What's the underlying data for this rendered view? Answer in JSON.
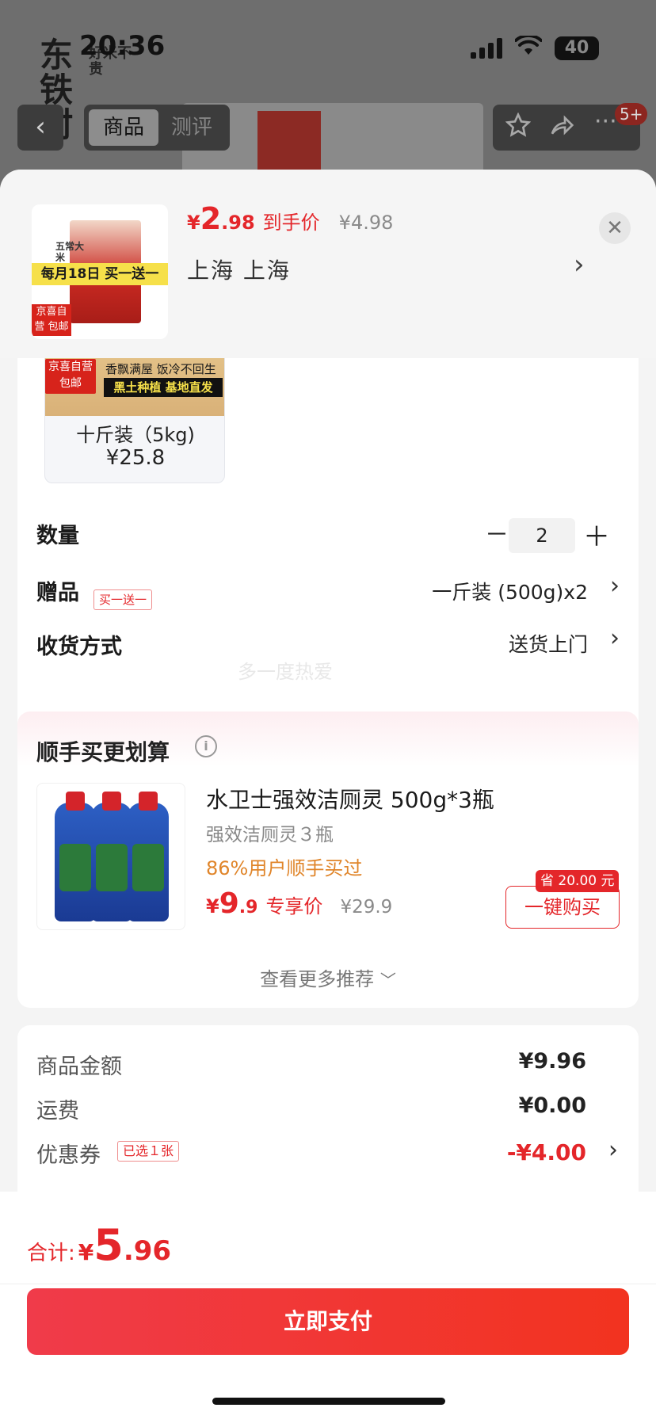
{
  "status_bar": {
    "time": "20:36",
    "battery": "40"
  },
  "background": {
    "logo_text_big": "东铁村",
    "logo_text_small": "好米不贵",
    "tabs": [
      {
        "label": "商品"
      },
      {
        "label": "测评"
      }
    ],
    "cart_badge": "5+"
  },
  "sheet_header": {
    "price": {
      "currency": "¥",
      "integer": "2",
      "decimal": ".98",
      "label": "到手价",
      "original": "¥4.98"
    },
    "location": "上海  上海",
    "thumb": {
      "banner": "每月18日 买一送一",
      "tag": "京喜自营 包邮",
      "brand": "五常大米"
    }
  },
  "spec_option": {
    "tag": "京喜自营 包邮",
    "img_line1": "香飘满屋 饭冷不回生",
    "img_line2": "黑土种植 基地直发",
    "name": "十斤装（5kg)",
    "price": "¥25.8"
  },
  "quantity": {
    "label": "数量",
    "value": "2",
    "minus": "－",
    "plus": "＋"
  },
  "gift": {
    "label": "赠品",
    "badge": "买一送一",
    "value": "一斤装 (500g)x2"
  },
  "delivery": {
    "label": "收货方式",
    "value": "送货上门"
  },
  "watermark": "多一度热爱",
  "recommend": {
    "title": "顺手买更划算",
    "item": {
      "name": "水卫士强效洁厕灵 500g*3瓶",
      "subtitle": "强效洁厕灵３瓶",
      "bought": "86%用户顺手买过",
      "price_currency": "¥",
      "price_integer": "9",
      "price_decimal": ".9",
      "price_label": "专享价",
      "price_original": "¥29.9",
      "save_badge": "省 20.00 元",
      "buy_label": "一键购买"
    },
    "more": "查看更多推荐"
  },
  "summary": {
    "goods_label": "商品金额",
    "goods_value": "¥9.96",
    "shipping_label": "运费",
    "shipping_value": "¥0.00",
    "coupon_label": "优惠券",
    "coupon_badge": "已选１张",
    "coupon_value": "-¥4.00"
  },
  "footer": {
    "total_label": "合计:",
    "total_currency": "¥",
    "total_integer": "5",
    "total_decimal": ".96",
    "pay_label": "立即支付"
  },
  "colors": {
    "accent": "#e4262a",
    "bought": "#e0852a",
    "pay_gradient_start": "#f03b4a",
    "pay_gradient_end": "#f2331f"
  },
  "icons": [
    "back-icon",
    "star-icon",
    "share-icon",
    "more-icon",
    "close-icon",
    "chevron-right-icon",
    "info-icon",
    "chevron-down-icon",
    "signal-icon",
    "wifi-icon",
    "battery-icon"
  ]
}
